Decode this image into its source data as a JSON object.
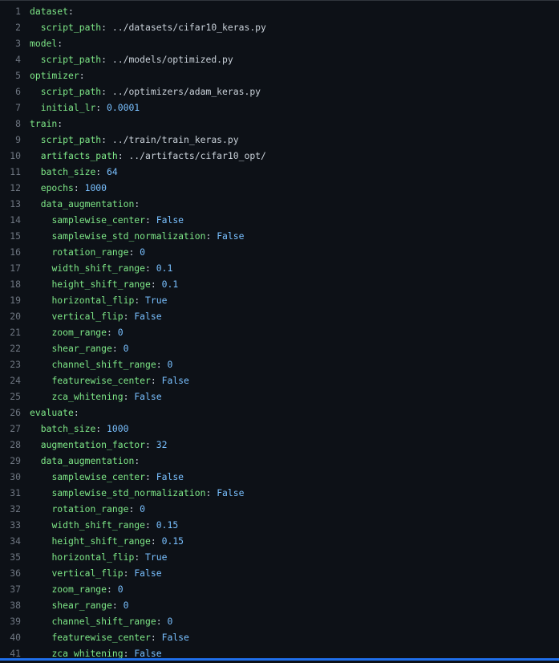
{
  "editor": {
    "lines": [
      {
        "n": "1",
        "indent": "",
        "key": "dataset",
        "value": "",
        "vtype": "str"
      },
      {
        "n": "2",
        "indent": "  ",
        "key": "script_path",
        "value": "../datasets/cifar10_keras.py",
        "vtype": "str"
      },
      {
        "n": "3",
        "indent": "",
        "key": "model",
        "value": "",
        "vtype": "str"
      },
      {
        "n": "4",
        "indent": "  ",
        "key": "script_path",
        "value": "../models/optimized.py",
        "vtype": "str"
      },
      {
        "n": "5",
        "indent": "",
        "key": "optimizer",
        "value": "",
        "vtype": "str"
      },
      {
        "n": "6",
        "indent": "  ",
        "key": "script_path",
        "value": "../optimizers/adam_keras.py",
        "vtype": "str"
      },
      {
        "n": "7",
        "indent": "  ",
        "key": "initial_lr",
        "value": "0.0001",
        "vtype": "num"
      },
      {
        "n": "8",
        "indent": "",
        "key": "train",
        "value": "",
        "vtype": "str"
      },
      {
        "n": "9",
        "indent": "  ",
        "key": "script_path",
        "value": "../train/train_keras.py",
        "vtype": "str"
      },
      {
        "n": "10",
        "indent": "  ",
        "key": "artifacts_path",
        "value": "../artifacts/cifar10_opt/",
        "vtype": "str"
      },
      {
        "n": "11",
        "indent": "  ",
        "key": "batch_size",
        "value": "64",
        "vtype": "num"
      },
      {
        "n": "12",
        "indent": "  ",
        "key": "epochs",
        "value": "1000",
        "vtype": "num"
      },
      {
        "n": "13",
        "indent": "  ",
        "key": "data_augmentation",
        "value": "",
        "vtype": "str"
      },
      {
        "n": "14",
        "indent": "    ",
        "key": "samplewise_center",
        "value": "False",
        "vtype": "bool"
      },
      {
        "n": "15",
        "indent": "    ",
        "key": "samplewise_std_normalization",
        "value": "False",
        "vtype": "bool"
      },
      {
        "n": "16",
        "indent": "    ",
        "key": "rotation_range",
        "value": "0",
        "vtype": "num"
      },
      {
        "n": "17",
        "indent": "    ",
        "key": "width_shift_range",
        "value": "0.1",
        "vtype": "num"
      },
      {
        "n": "18",
        "indent": "    ",
        "key": "height_shift_range",
        "value": "0.1",
        "vtype": "num"
      },
      {
        "n": "19",
        "indent": "    ",
        "key": "horizontal_flip",
        "value": "True",
        "vtype": "bool"
      },
      {
        "n": "20",
        "indent": "    ",
        "key": "vertical_flip",
        "value": "False",
        "vtype": "bool"
      },
      {
        "n": "21",
        "indent": "    ",
        "key": "zoom_range",
        "value": "0",
        "vtype": "num"
      },
      {
        "n": "22",
        "indent": "    ",
        "key": "shear_range",
        "value": "0",
        "vtype": "num"
      },
      {
        "n": "23",
        "indent": "    ",
        "key": "channel_shift_range",
        "value": "0",
        "vtype": "num"
      },
      {
        "n": "24",
        "indent": "    ",
        "key": "featurewise_center",
        "value": "False",
        "vtype": "bool"
      },
      {
        "n": "25",
        "indent": "    ",
        "key": "zca_whitening",
        "value": "False",
        "vtype": "bool"
      },
      {
        "n": "26",
        "indent": "",
        "key": "evaluate",
        "value": "",
        "vtype": "str"
      },
      {
        "n": "27",
        "indent": "  ",
        "key": "batch_size",
        "value": "1000",
        "vtype": "num"
      },
      {
        "n": "28",
        "indent": "  ",
        "key": "augmentation_factor",
        "value": "32",
        "vtype": "num"
      },
      {
        "n": "29",
        "indent": "  ",
        "key": "data_augmentation",
        "value": "",
        "vtype": "str"
      },
      {
        "n": "30",
        "indent": "    ",
        "key": "samplewise_center",
        "value": "False",
        "vtype": "bool"
      },
      {
        "n": "31",
        "indent": "    ",
        "key": "samplewise_std_normalization",
        "value": "False",
        "vtype": "bool"
      },
      {
        "n": "32",
        "indent": "    ",
        "key": "rotation_range",
        "value": "0",
        "vtype": "num"
      },
      {
        "n": "33",
        "indent": "    ",
        "key": "width_shift_range",
        "value": "0.15",
        "vtype": "num"
      },
      {
        "n": "34",
        "indent": "    ",
        "key": "height_shift_range",
        "value": "0.15",
        "vtype": "num"
      },
      {
        "n": "35",
        "indent": "    ",
        "key": "horizontal_flip",
        "value": "True",
        "vtype": "bool"
      },
      {
        "n": "36",
        "indent": "    ",
        "key": "vertical_flip",
        "value": "False",
        "vtype": "bool"
      },
      {
        "n": "37",
        "indent": "    ",
        "key": "zoom_range",
        "value": "0",
        "vtype": "num"
      },
      {
        "n": "38",
        "indent": "    ",
        "key": "shear_range",
        "value": "0",
        "vtype": "num"
      },
      {
        "n": "39",
        "indent": "    ",
        "key": "channel_shift_range",
        "value": "0",
        "vtype": "num"
      },
      {
        "n": "40",
        "indent": "    ",
        "key": "featurewise_center",
        "value": "False",
        "vtype": "bool"
      },
      {
        "n": "41",
        "indent": "    ",
        "key": "zca_whitening",
        "value": "False",
        "vtype": "bool"
      }
    ]
  },
  "colors": {
    "background": "#0d1117",
    "line_number": "#6e7681",
    "key": "#7ee787",
    "text": "#c9d1d9",
    "literal": "#79c0ff",
    "accent_bar": "#1f6feb"
  }
}
